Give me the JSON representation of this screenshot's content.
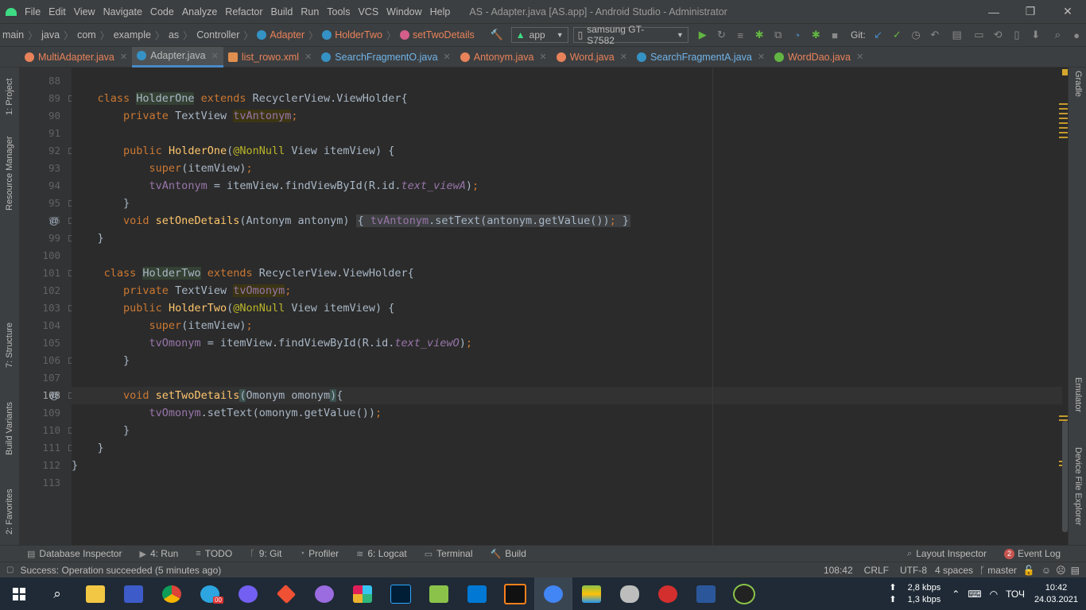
{
  "menubar": {
    "items": [
      "File",
      "Edit",
      "View",
      "Navigate",
      "Code",
      "Analyze",
      "Refactor",
      "Build",
      "Run",
      "Tools",
      "VCS",
      "Window",
      "Help"
    ],
    "title": "AS - Adapter.java [AS.app] - Android Studio - Administrator",
    "controls": {
      "minimize": "—",
      "maximize": "❐",
      "close": "✕"
    }
  },
  "navbar": {
    "crumbs": [
      "main",
      "java",
      "com",
      "example",
      "as",
      "Controller",
      "Adapter",
      "HolderTwo",
      "setTwoDetails"
    ],
    "run_config": "app",
    "device": "samsung GT-S7582",
    "git_label": "Git:"
  },
  "tabs": [
    "MultiAdapter.java",
    "Adapter.java",
    "list_rowo.xml",
    "SearchFragmentO.java",
    "Antonym.java",
    "Word.java",
    "SearchFragmentA.java",
    "WordDao.java"
  ],
  "active_tab": 1,
  "tab_colors": [
    "#e8825a",
    "#3592c4",
    "#e08f4f",
    "#3592c4",
    "#e8825a",
    "#e8825a",
    "#3592c4",
    "#62b543"
  ],
  "left_strip": {
    "project": "1: Project",
    "resource": "Resource Manager",
    "structure": "7: Structure",
    "variants": "Build Variants",
    "favorites": "2: Favorites"
  },
  "right_strip": {
    "gradle": "Gradle",
    "emulator": "Emulator",
    "device_explorer": "Device File Explorer"
  },
  "gutter": {
    "numbers": [
      "88",
      "89",
      "90",
      "91",
      "92",
      "93",
      "94",
      "95",
      "96",
      "99",
      "100",
      "101",
      "102",
      "103",
      "104",
      "105",
      "106",
      "107",
      "108",
      "109",
      "110",
      "111",
      "112",
      "113"
    ],
    "at_marker": "@"
  },
  "toolwindows": [
    "Database Inspector",
    "4: Run",
    "TODO",
    "9: Git",
    "Profiler",
    "6: Logcat",
    "Terminal",
    "Build"
  ],
  "toolwindows_right": {
    "layout": "Layout Inspector",
    "event_count": "2",
    "event": "Event Log"
  },
  "status": {
    "message": "Success: Operation succeeded (5 minutes ago)",
    "position": "108:42",
    "line_sep": "CRLF",
    "encoding": "UTF-8",
    "indent": "4 spaces",
    "branch": "master"
  },
  "taskbar": {
    "net_up": "2,8 kbps",
    "net_down": "1,3 kbps",
    "lang": "ТОЧ",
    "time": "10:42",
    "date": "24.03.2021",
    "badge": "00"
  }
}
